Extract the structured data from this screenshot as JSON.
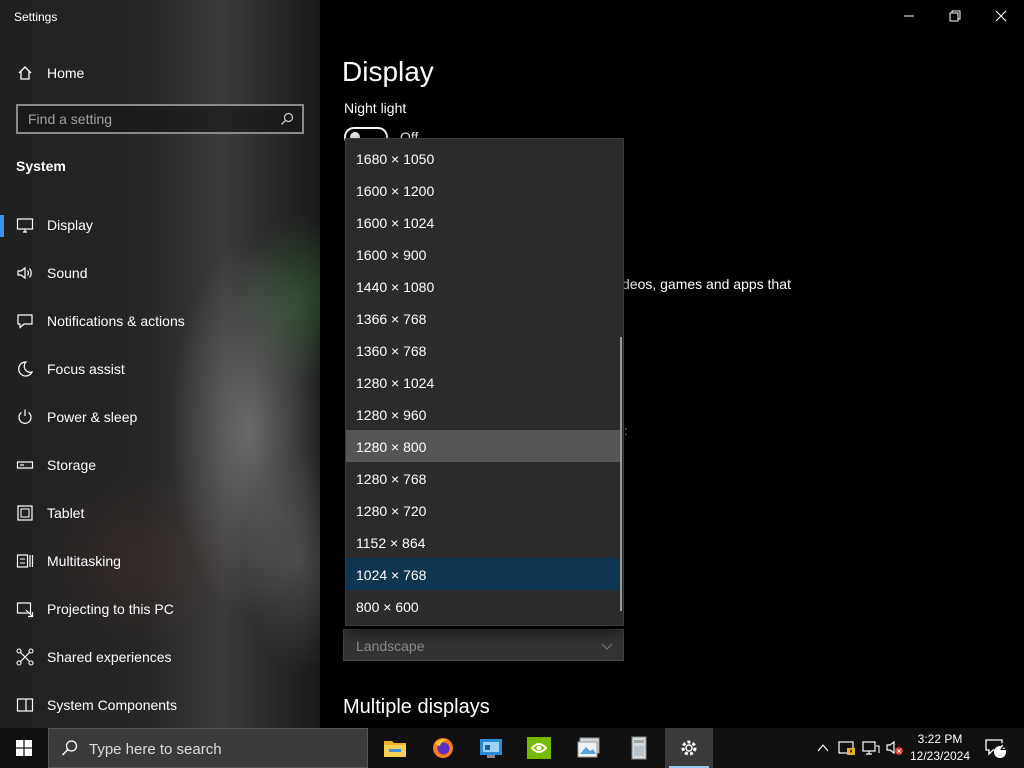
{
  "window": {
    "title": "Settings"
  },
  "sidebar": {
    "home_label": "Home",
    "search_placeholder": "Find a setting",
    "section_title": "System",
    "items": [
      {
        "label": "Display",
        "icon": "monitor-icon",
        "selected": true
      },
      {
        "label": "Sound",
        "icon": "speaker-icon"
      },
      {
        "label": "Notifications & actions",
        "icon": "notification-icon"
      },
      {
        "label": "Focus assist",
        "icon": "moon-icon"
      },
      {
        "label": "Power & sleep",
        "icon": "power-icon"
      },
      {
        "label": "Storage",
        "icon": "storage-icon"
      },
      {
        "label": "Tablet",
        "icon": "tablet-icon"
      },
      {
        "label": "Multitasking",
        "icon": "multitasking-icon"
      },
      {
        "label": "Projecting to this PC",
        "icon": "projecting-icon"
      },
      {
        "label": "Shared experiences",
        "icon": "shared-experiences-icon"
      },
      {
        "label": "System Components",
        "icon": "system-components-icon"
      }
    ]
  },
  "main": {
    "heading": "Display",
    "night_light_label": "Night light",
    "night_light_state": "Off",
    "partial_text": "deos, games and apps that",
    "stray_mark": ":",
    "orientation_value": "Landscape",
    "multiple_displays_heading": "Multiple displays"
  },
  "resolution_dropdown": {
    "options": [
      "1680 × 1050",
      "1600 × 1200",
      "1600 × 1024",
      "1600 × 900",
      "1440 × 1080",
      "1366 × 768",
      "1360 × 768",
      "1280 × 1024",
      "1280 × 960",
      "1280 × 800",
      "1280 × 768",
      "1280 × 720",
      "1152 × 864",
      "1024 × 768",
      "800 × 600"
    ],
    "hovered": "1280 × 800",
    "selected": "1024 × 768"
  },
  "taskbar": {
    "search_placeholder": "Type here to search",
    "apps": [
      "file-explorer-icon",
      "firefox-icon",
      "control-panel-icon",
      "nvidia-icon",
      "photos-icon",
      "files-icon",
      "settings-icon"
    ],
    "clock_time": "3:22 PM",
    "clock_date": "12/23/2024",
    "notification_count": "2"
  },
  "colors": {
    "accent": "#3a93e6",
    "selected_option": "#0f3651",
    "hover_option": "#555555"
  }
}
